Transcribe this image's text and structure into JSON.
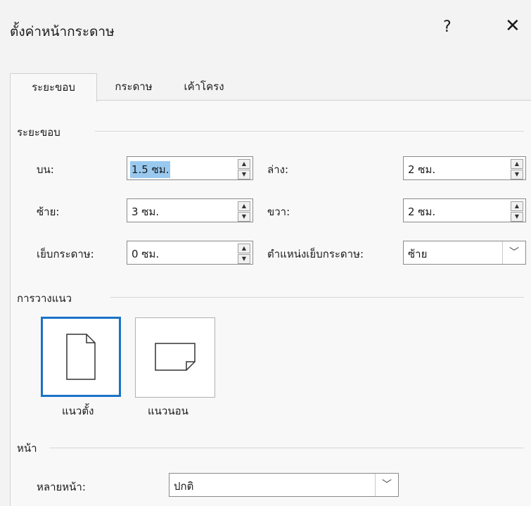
{
  "dialog": {
    "title": "ตั้งค่าหน้ากระดาษ",
    "help": "?",
    "close": "✕"
  },
  "tabs": [
    {
      "label": "ระยะขอบ",
      "active": true
    },
    {
      "label": "กระดาษ",
      "active": false
    },
    {
      "label": "เค้าโครง",
      "active": false
    }
  ],
  "margins": {
    "group_label": "ระยะขอบ",
    "top": {
      "label": "บน:",
      "value": "1.5 ซม."
    },
    "bottom": {
      "label": "ล่าง:",
      "value": "2 ซม."
    },
    "left": {
      "label": "ซ้าย:",
      "value": "3 ซม."
    },
    "right": {
      "label": "ขวา:",
      "value": "2 ซม."
    },
    "gutter": {
      "label": "เย็บกระดาษ:",
      "value": "0 ซม."
    },
    "gutter_position": {
      "label": "ตำแหน่งเย็บกระดาษ:",
      "value": "ซ้าย"
    }
  },
  "orientation": {
    "group_label": "การวางแนว",
    "portrait": "แนวตั้ง",
    "landscape": "แนวนอน",
    "selected": "portrait"
  },
  "pages": {
    "group_label": "หน้า",
    "multiple_label": "หลายหน้า:",
    "multiple_value": "ปกติ"
  }
}
